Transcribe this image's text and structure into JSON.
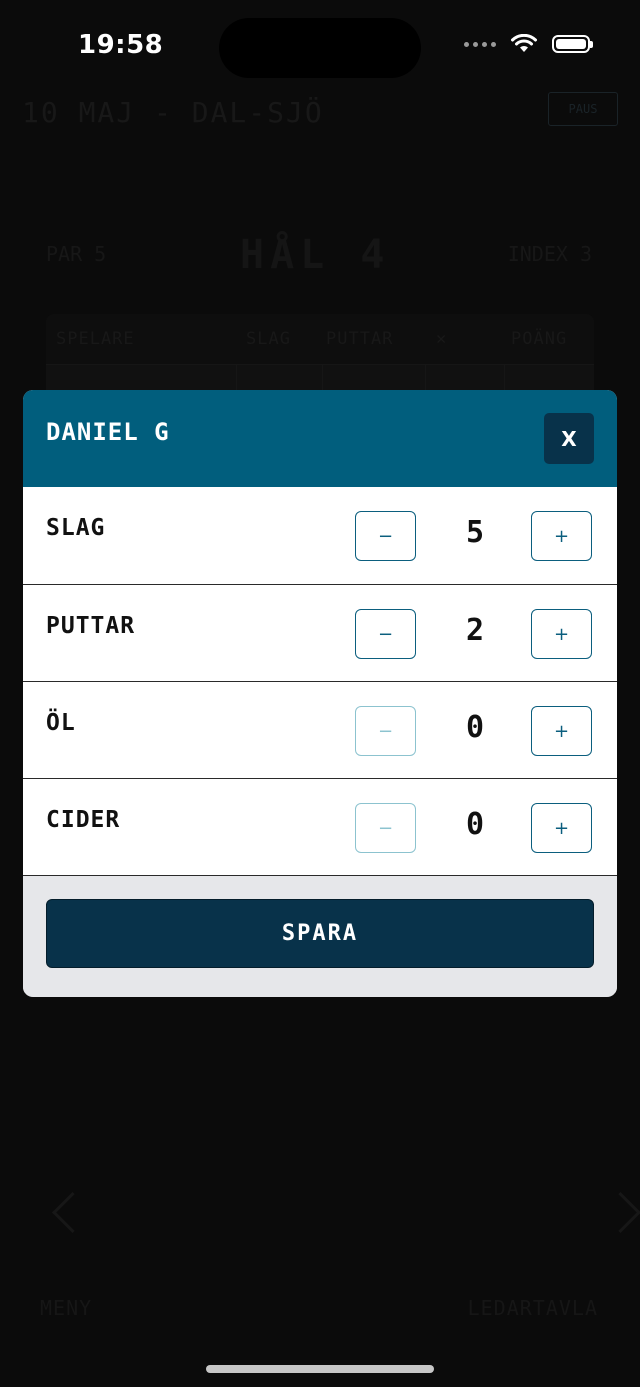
{
  "status_bar": {
    "time": "19:58"
  },
  "background": {
    "title": "10 MAJ - DAL-SJÖ",
    "pill_label": "PAUS",
    "par": "PAR 5",
    "hole": "HÅL 4",
    "index": "INDEX 3",
    "table_headers": [
      "SPELARE",
      "SLAG",
      "PUTTAR",
      "",
      "POÄNG"
    ],
    "menu": "MENY",
    "leaderboard": "LEDARTAVLA"
  },
  "modal": {
    "title": "DANIEL G",
    "close_label": "X",
    "rows": [
      {
        "label": "SLAG",
        "value": "5",
        "minus_enabled": true
      },
      {
        "label": "PUTTAR",
        "value": "2",
        "minus_enabled": true
      },
      {
        "label": "ÖL",
        "value": "0",
        "minus_enabled": false
      },
      {
        "label": "CIDER",
        "value": "0",
        "minus_enabled": false
      }
    ],
    "minus_label": "−",
    "plus_label": "+",
    "save_label": "SPARA"
  },
  "colors": {
    "header": "#015e7d",
    "button_dark": "#08324a",
    "accent": "#0b5e7e",
    "disabled": "#8cc3cf"
  }
}
